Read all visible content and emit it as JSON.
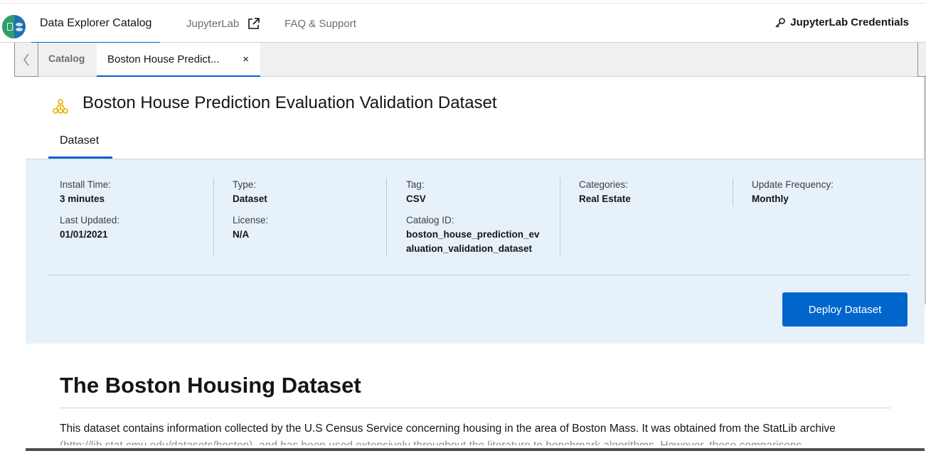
{
  "nav": {
    "catalog": "Data Explorer Catalog",
    "jupyterlab": "JupyterLab",
    "faq": "FAQ & Support",
    "credentials": "JupyterLab Credentials"
  },
  "tabs": {
    "catalog": "Catalog",
    "boston": "Boston House Predict...",
    "close": "×"
  },
  "dataset": {
    "title": "Boston House Prediction Evaluation Validation Dataset",
    "tab": "Dataset",
    "fields": {
      "install_time": {
        "label": "Install Time:",
        "value": "3 minutes"
      },
      "type": {
        "label": "Type:",
        "value": "Dataset"
      },
      "tag": {
        "label": "Tag:",
        "value": "CSV"
      },
      "categories": {
        "label": "Categories:",
        "value": "Real Estate"
      },
      "update_frequency": {
        "label": "Update Frequency:",
        "value": "Monthly"
      },
      "last_updated": {
        "label": "Last Updated:",
        "value": "01/01/2021"
      },
      "license": {
        "label": "License:",
        "value": "N/A"
      },
      "catalog_id": {
        "label": "Catalog ID:",
        "value_line1": "boston_house_prediction_ev",
        "value_line2": "aluation_validation_dataset"
      }
    },
    "deploy_button": "Deploy Dataset"
  },
  "content": {
    "heading": "The Boston Housing Dataset",
    "paragraph": "This dataset contains information collected by the U.S Census Service concerning housing in the area of Boston Mass. It was obtained from the StatLib archive",
    "paragraph_cont": "(http://lib.stat.cmu.edu/datasets/boston), and has been used extensively throughout the literature to benchmark algorithms. However, these comparisons"
  },
  "colors": {
    "accent": "#0066cc",
    "panel_bg": "#e7f1fa",
    "icon_orange": "#f0ab00"
  }
}
